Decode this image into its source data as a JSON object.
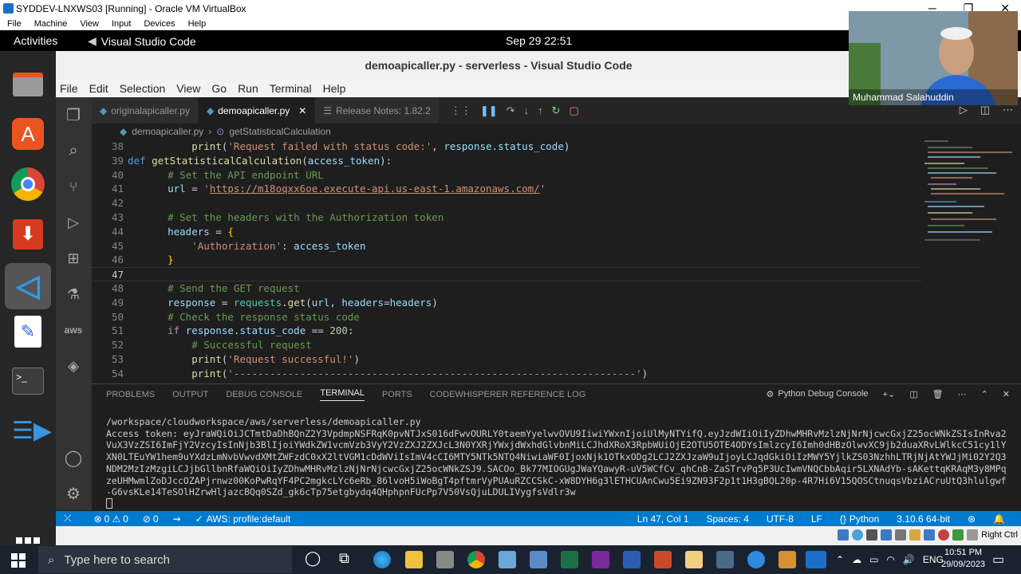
{
  "vbox": {
    "title": "SYDDEV-LNXWS03 [Running] - Oracle VM VirtualBox",
    "menu": [
      "File",
      "Machine",
      "View",
      "Input",
      "Devices",
      "Help"
    ],
    "host_key": "Right Ctrl"
  },
  "gnome": {
    "activities": "Activities",
    "app_name": "Visual Studio Code",
    "clock": "Sep 29  22:51"
  },
  "vscode": {
    "window_title": "demoapicaller.py - serverless - Visual Studio Code",
    "menu": [
      "File",
      "Edit",
      "Selection",
      "View",
      "Go",
      "Run",
      "Terminal",
      "Help"
    ],
    "tabs": [
      {
        "label": "originalapicaller.py"
      },
      {
        "label": "demoapicaller.py"
      },
      {
        "label": "Release Notes: 1.82.2"
      }
    ],
    "breadcrumb": {
      "file": "demoapicaller.py",
      "symbol": "getStatisticalCalculation"
    },
    "code": {
      "l38": "38",
      "l39": "39",
      "l40": "40",
      "l41": "41",
      "l42": "42",
      "l43": "43",
      "l44": "44",
      "l45": "45",
      "l46": "46",
      "l47": "47",
      "l48": "48",
      "l49": "49",
      "l50": "50",
      "l51": "51",
      "l52": "52",
      "l53": "53",
      "l54": "54",
      "s38": "'Request failed with status code:'",
      "fn_name": "getStatisticalCalculation",
      "c40": "# Set the API endpoint URL",
      "url": "https://m18oqxx6oe.execute-api.us-east-1.amazonaws.com/",
      "c43": "# Set the headers with the Authorization token",
      "s45": "'Authorization'",
      "c48": "# Send the GET request",
      "c50": "# Check the response status code",
      "n51": "200",
      "c52": "# Successful request",
      "s53": "'Request successful!'",
      "s54": "'-------------------------------------------------------------------'"
    },
    "panel": {
      "tabs": [
        "PROBLEMS",
        "OUTPUT",
        "DEBUG CONSOLE",
        "TERMINAL",
        "PORTS",
        "CODEWHISPERER REFERENCE LOG"
      ],
      "active_tab": "TERMINAL",
      "debug_console": "Python Debug Console",
      "terminal_path": "/workspace/cloudworkspace/aws/serverless/demoapicaller.py",
      "terminal_token": "Access token: eyJraWQiOiJCTmtDaDhBQnZ2Y3VpdmpNSFRqK0pvNTJxS016dFwvOURLY0taemYyelwvOVU9IiwiYWxnIjoiUlMyNTYifQ.eyJzdWIiOiIyZDhwMHRvMzlzNjNrNjcwcGxjZ25ocWNkZSIsInRva2VuX3VzZSI6ImFjY2VzcyIsInNjb3BlIjoiYWdkZW1vcmVzb3VyY2VzZXJ2ZXJcL3N0YXRjYWxjdWxhdGlvbnMiLCJhdXRoX3RpbWUiOjE2OTU5OTE4ODYsImlzcyI6Imh0dHBzOlwvXC9jb2duaXRvLWlkcC51cy1lYXN0LTEuYW1hem9uYXdzLmNvbVwvdXMtZWFzdC0xX2ltVGM1cDdWViIsImV4cCI6MTY5NTk5NTQ4NiwiaWF0IjoxNjk1OTkxODg2LCJ2ZXJzaW9uIjoyLCJqdGkiOiIzMWY5YjlkZS03NzhhLTRjNjAtYWJjMi02Y2Q3NDM2MzIzMzgiLCJjbGllbnRfaWQiOiIyZDhwMHRvMzlzNjNrNjcwcGxjZ25ocWNkZSJ9.SACOo_Bk77MIOGUgJWaYQawyR-uV5WCfCv_qhCnB-ZaSTrvPq5P3UcIwmVNQCbbAqir5LXNAdYb-sAKettqKRAqM3y8MPqzeUHMwmlZoDJccOZAPjrnwz00KoPwRqYF4PC2mgkcLYc6eRb_86lvoH5iWoBgT4pftmrVyPUAuRZCCSkC-xW8DYH6g3lETHCUAnCwu5Ei9ZN93F2p1t1H3gBQL20p-4R7Hi6V15QOSCtnuqsVbziACruUtQ3hlulgwf-G6vsKLe14TeSOlHZrwHljazcBQq0SZd_gk6cTp75etgbydq4QHphpnFUcPp7V50VsQjuLDULIVygfsVdlr3w"
    },
    "status": {
      "errors": "0",
      "warnings": "0",
      "ports": "0",
      "aws_profile": "AWS: profile:default",
      "position": "Ln 47, Col 1",
      "spaces": "Spaces: 4",
      "encoding": "UTF-8",
      "eol": "LF",
      "language": "Python",
      "interpreter": "3.10.6 64-bit"
    }
  },
  "webcam": {
    "name": "Muhammad Salahuddin"
  },
  "taskbar": {
    "search_placeholder": "Type here to search",
    "lang": "ENG",
    "time": "10:51 PM",
    "date": "29/09/2023"
  },
  "colors": {
    "accent": "#007acc",
    "keyword": "#569cd6",
    "string": "#ce9178",
    "comment": "#6a9955",
    "function": "#dcdcaa"
  }
}
